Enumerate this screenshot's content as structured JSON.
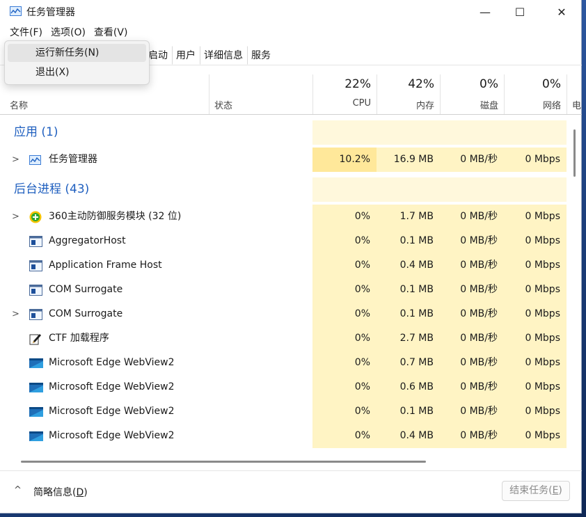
{
  "window": {
    "title": "任务管理器",
    "minimize": "—",
    "maximize": "☐",
    "close": "✕"
  },
  "menu": [
    "文件(F)",
    "选项(O)",
    "查看(V)"
  ],
  "dropdown": [
    "运行新任务(N)",
    "退出(X)"
  ],
  "tabs": [
    "启动",
    "用户",
    "详细信息",
    "服务"
  ],
  "header": {
    "name": "名称",
    "status": "状态",
    "columns": [
      {
        "pct": "22%",
        "label": "CPU"
      },
      {
        "pct": "42%",
        "label": "内存"
      },
      {
        "pct": "0%",
        "label": "磁盘"
      },
      {
        "pct": "0%",
        "label": "网络"
      },
      {
        "pct": "",
        "label": "电"
      }
    ]
  },
  "sections": {
    "apps": "应用 (1)",
    "background": "后台进程 (43)"
  },
  "apps": [
    {
      "name": "任务管理器",
      "icon": "taskmgr-icon",
      "expandable": true,
      "cpu": "10.2%",
      "mem": "16.9 MB",
      "disk": "0 MB/秒",
      "net": "0 Mbps"
    }
  ],
  "processes": [
    {
      "name": "360主动防御服务模块 (32 位)",
      "icon": "shield-plus-icon",
      "expandable": true,
      "cpu": "0%",
      "mem": "1.7 MB",
      "disk": "0 MB/秒",
      "net": "0 Mbps"
    },
    {
      "name": "AggregatorHost",
      "icon": "app-window-icon",
      "expandable": false,
      "cpu": "0%",
      "mem": "0.1 MB",
      "disk": "0 MB/秒",
      "net": "0 Mbps"
    },
    {
      "name": "Application Frame Host",
      "icon": "app-window-icon",
      "expandable": false,
      "cpu": "0%",
      "mem": "0.4 MB",
      "disk": "0 MB/秒",
      "net": "0 Mbps"
    },
    {
      "name": "COM Surrogate",
      "icon": "app-window-icon",
      "expandable": false,
      "cpu": "0%",
      "mem": "0.1 MB",
      "disk": "0 MB/秒",
      "net": "0 Mbps"
    },
    {
      "name": "COM Surrogate",
      "icon": "app-window-icon",
      "expandable": true,
      "cpu": "0%",
      "mem": "0.1 MB",
      "disk": "0 MB/秒",
      "net": "0 Mbps"
    },
    {
      "name": "CTF 加载程序",
      "icon": "pen-icon",
      "expandable": false,
      "cpu": "0%",
      "mem": "2.7 MB",
      "disk": "0 MB/秒",
      "net": "0 Mbps"
    },
    {
      "name": "Microsoft Edge WebView2",
      "icon": "edge-webview-icon",
      "expandable": false,
      "cpu": "0%",
      "mem": "0.7 MB",
      "disk": "0 MB/秒",
      "net": "0 Mbps"
    },
    {
      "name": "Microsoft Edge WebView2",
      "icon": "edge-webview-icon",
      "expandable": false,
      "cpu": "0%",
      "mem": "0.6 MB",
      "disk": "0 MB/秒",
      "net": "0 Mbps"
    },
    {
      "name": "Microsoft Edge WebView2",
      "icon": "edge-webview-icon",
      "expandable": false,
      "cpu": "0%",
      "mem": "0.1 MB",
      "disk": "0 MB/秒",
      "net": "0 Mbps"
    },
    {
      "name": "Microsoft Edge WebView2",
      "icon": "edge-webview-icon",
      "expandable": false,
      "cpu": "0%",
      "mem": "0.4 MB",
      "disk": "0 MB/秒",
      "net": "0 Mbps"
    }
  ],
  "footer": {
    "chevron": "^",
    "summary_prefix": "简略信息(",
    "summary_key": "D",
    "summary_suffix": ")",
    "end_prefix": "结束任务(",
    "end_key": "E",
    "end_suffix": ")"
  }
}
